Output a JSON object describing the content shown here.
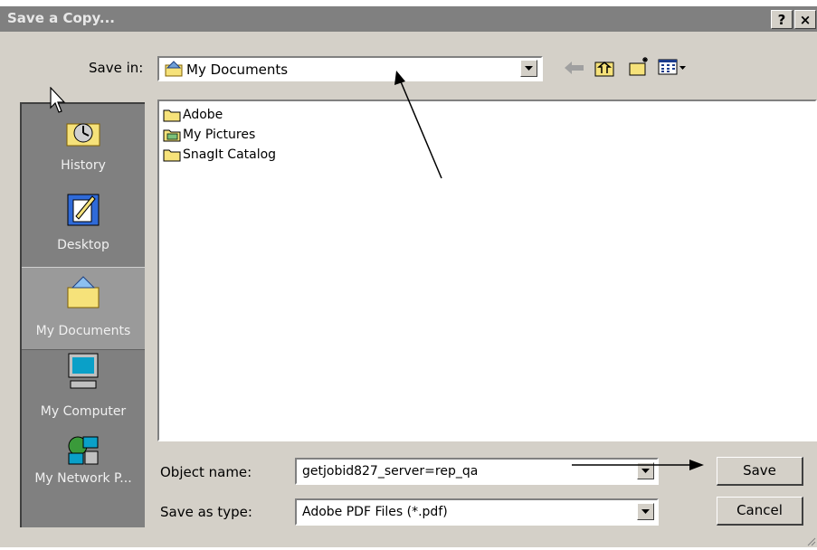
{
  "window": {
    "title": "Save a Copy...",
    "help_label": "?",
    "close_label": "×"
  },
  "save_in": {
    "label": "Save in:",
    "value": "My Documents"
  },
  "places_bar": [
    {
      "label": "History",
      "icon": "history-icon"
    },
    {
      "label": "Desktop",
      "icon": "desktop-icon"
    },
    {
      "label": "My Documents",
      "icon": "my-documents-icon",
      "selected": true
    },
    {
      "label": "My Computer",
      "icon": "my-computer-icon"
    },
    {
      "label": "My Network P...",
      "icon": "my-network-places-icon"
    }
  ],
  "files": [
    {
      "name": "Adobe",
      "icon": "folder-icon"
    },
    {
      "name": "My Pictures",
      "icon": "pictures-folder-icon"
    },
    {
      "name": "SnagIt Catalog",
      "icon": "folder-icon"
    }
  ],
  "object_name": {
    "label": "Object name:",
    "value": "getjobid827_server=rep_qa"
  },
  "save_as_type": {
    "label": "Save as type:",
    "value": "Adobe PDF Files (*.pdf)"
  },
  "buttons": {
    "save": "Save",
    "cancel": "Cancel"
  },
  "colors": {
    "titlebar": "#808080",
    "dialog": "#d4d0c8",
    "places_bar": "#808080",
    "folder": "#f6e27a"
  }
}
